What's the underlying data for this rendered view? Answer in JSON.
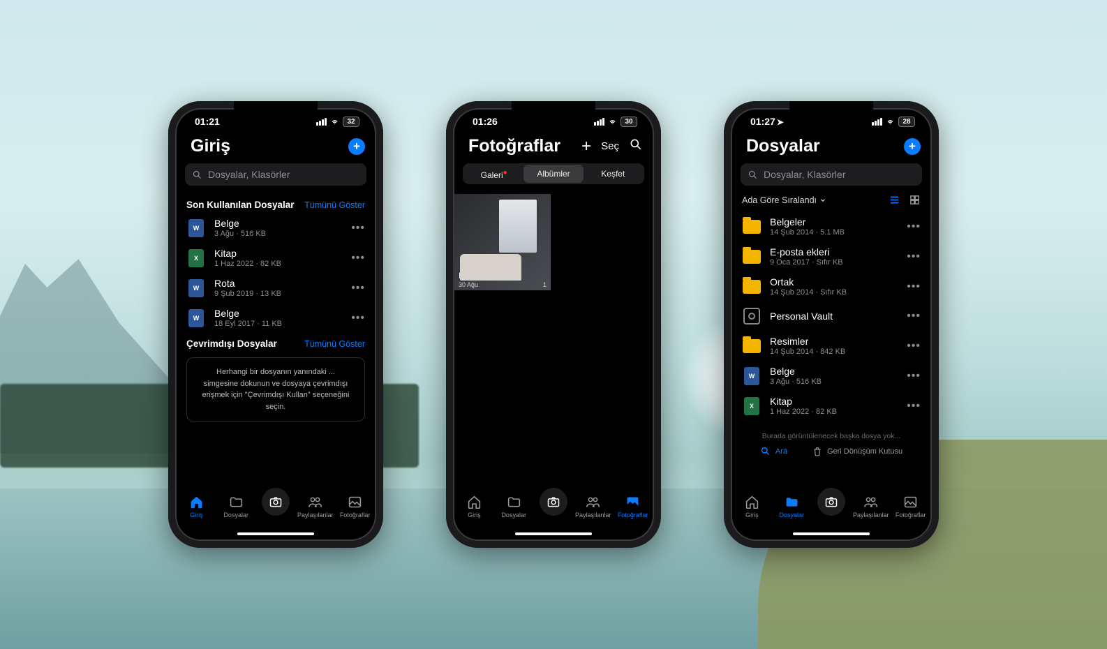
{
  "icons": {
    "signal": "sig",
    "wifi": "wifi",
    "battery": "batt"
  },
  "tabs": {
    "home": "Giriş",
    "files": "Dosyalar",
    "shared": "Paylaşılanlar",
    "photos": "Fotoğraflar"
  },
  "phone1": {
    "status": {
      "time": "01:21",
      "battery": "32"
    },
    "title": "Giriş",
    "searchPlaceholder": "Dosyalar, Klasörler",
    "sectionRecent": "Son Kullanılan Dosyalar",
    "showAll": "Tümünü Göster",
    "files": [
      {
        "icon": "word",
        "badge": "W",
        "name": "Belge",
        "sub": "3 Ağu · 516 KB"
      },
      {
        "icon": "excel",
        "badge": "X",
        "name": "Kitap",
        "sub": "1 Haz 2022 · 82 KB"
      },
      {
        "icon": "word",
        "badge": "W",
        "name": "Rota",
        "sub": "9 Şub 2019 · 13 KB"
      },
      {
        "icon": "word",
        "badge": "W",
        "name": "Belge",
        "sub": "18 Eyl 2017 · 11 KB"
      }
    ],
    "sectionOffline": "Çevrimdışı Dosyalar",
    "hint": "Herhangi bir dosyanın yanındaki ... simgesine dokunun ve dosyaya çevrimdışı erişmek için \"Çevrimdışı Kullan\" seçeneğini seçin."
  },
  "phone2": {
    "status": {
      "time": "01:26",
      "battery": "30"
    },
    "title": "Fotoğraflar",
    "selectLabel": "Seç",
    "segments": {
      "gallery": "Galeri",
      "albums": "Albümler",
      "explore": "Keşfet"
    },
    "album": {
      "name": "Ev",
      "date": "30 Ağu",
      "count": "1"
    }
  },
  "phone3": {
    "status": {
      "time": "01:27",
      "battery": "28"
    },
    "title": "Dosyalar",
    "searchPlaceholder": "Dosyalar, Klasörler",
    "sortLabel": "Ada Göre Sıralandı",
    "items": [
      {
        "type": "folder",
        "name": "Belgeler",
        "sub": "14 Şub 2014 · 5.1 MB"
      },
      {
        "type": "folder",
        "name": "E-posta ekleri",
        "sub": "9 Oca 2017 · Sıfır KB"
      },
      {
        "type": "folder",
        "name": "Ortak",
        "sub": "14 Şub 2014 · Sıfır KB"
      },
      {
        "type": "vault",
        "name": "Personal Vault",
        "sub": ""
      },
      {
        "type": "folder",
        "name": "Resimler",
        "sub": "14 Şub 2014 · 842 KB"
      },
      {
        "type": "word",
        "badge": "W",
        "name": "Belge",
        "sub": "3 Ağu · 516 KB"
      },
      {
        "type": "excel",
        "badge": "X",
        "name": "Kitap",
        "sub": "1 Haz 2022 · 82 KB"
      }
    ],
    "emptyNote": "Burada görüntülenecek başka dosya yok...",
    "searchAction": "Ara",
    "recycleAction": "Geri Dönüşüm Kutusu"
  }
}
